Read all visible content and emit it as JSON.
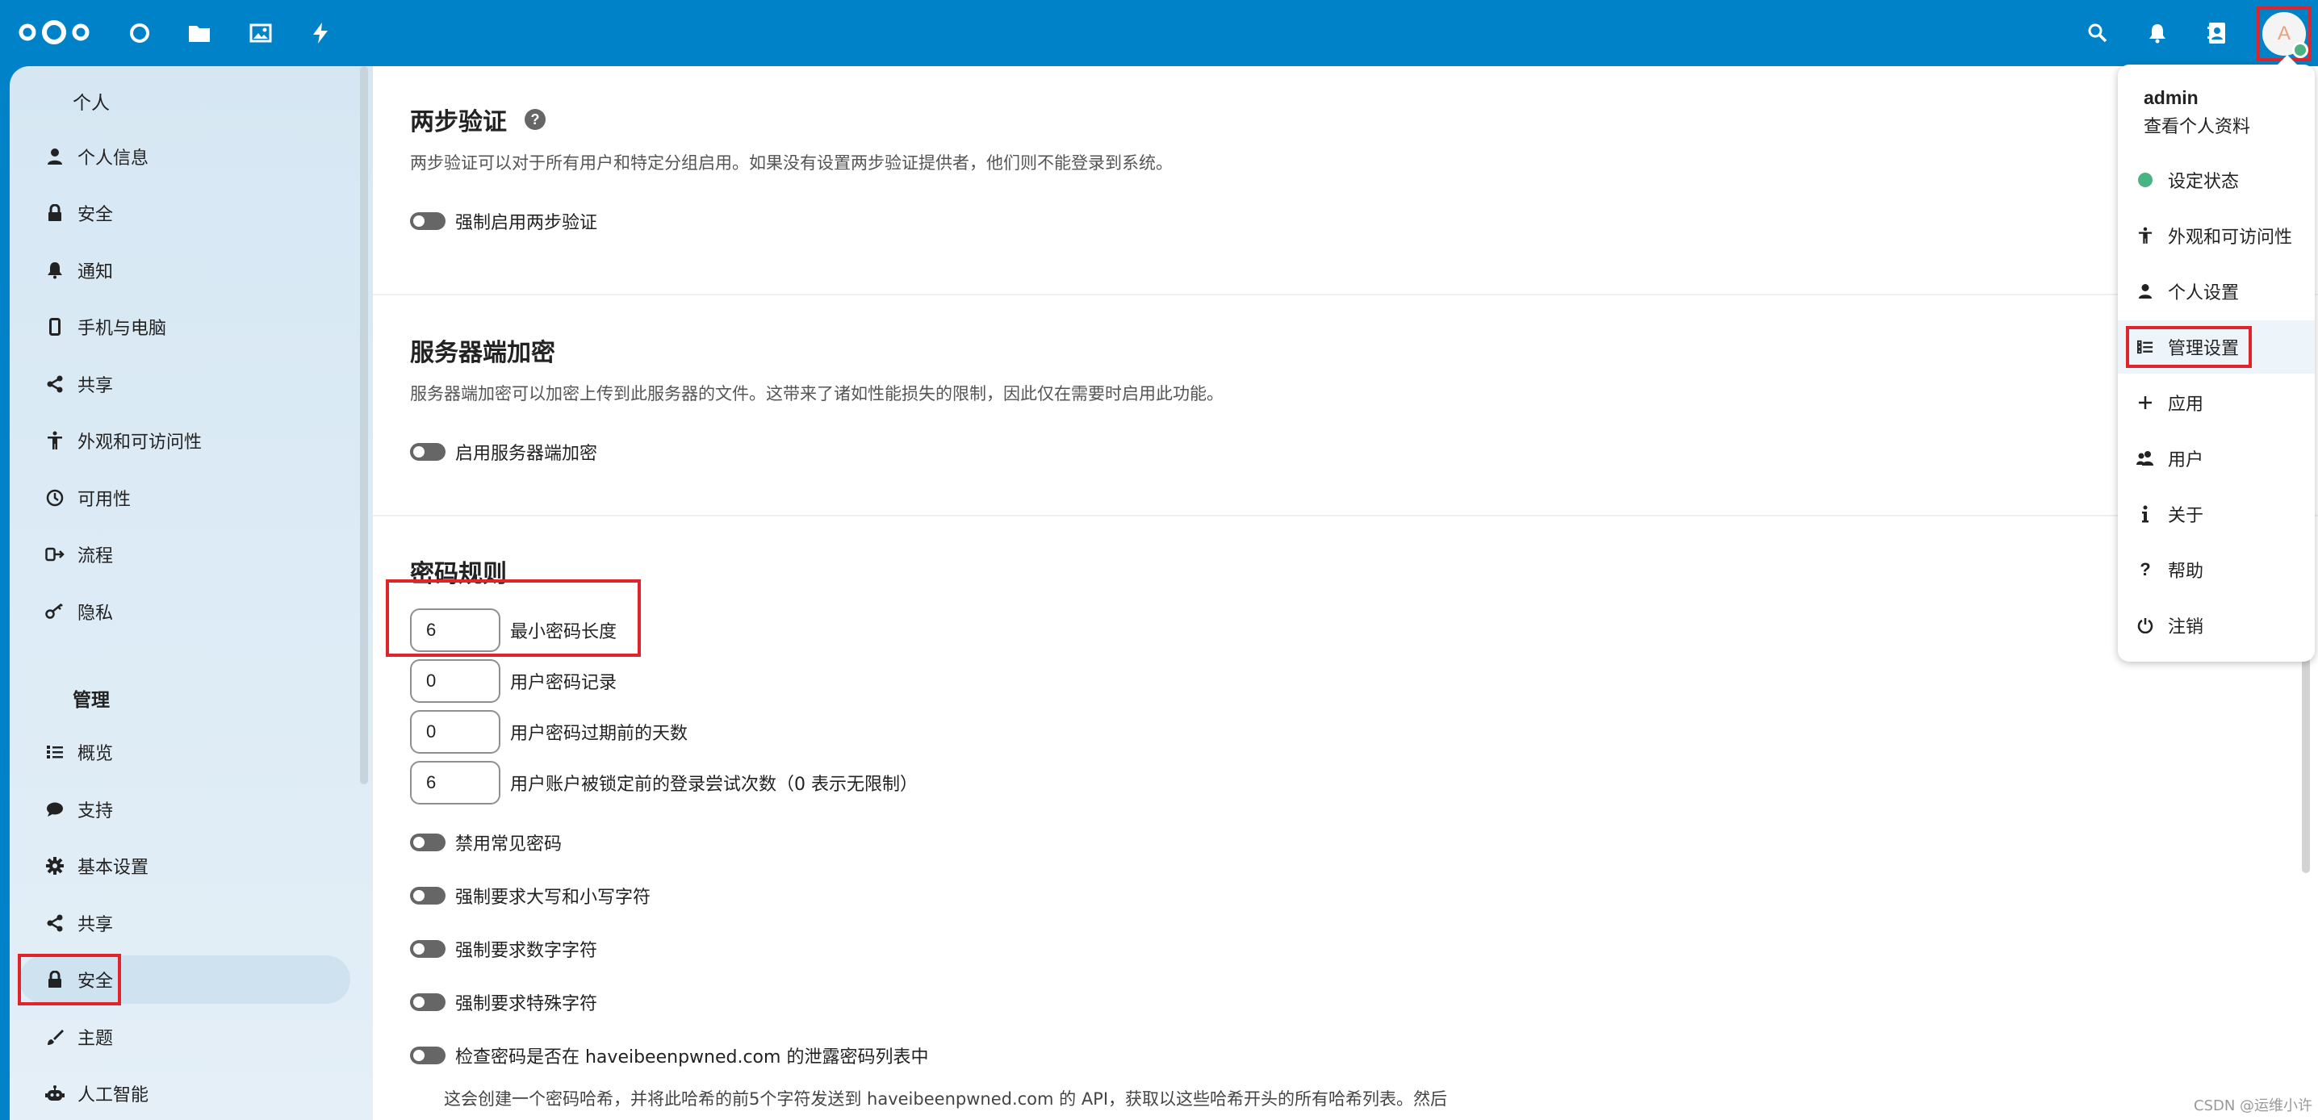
{
  "header": {
    "logo": "nextcloud-logo",
    "apps": [
      "dashboard",
      "files",
      "photos",
      "activity"
    ],
    "right_icons": [
      "search",
      "notifications",
      "contacts"
    ],
    "avatar_letter": "A",
    "status_color": "#49b382"
  },
  "sidebar": {
    "personal_title": "个人",
    "personal_items": [
      {
        "label": "个人信息",
        "icon": "person-icon"
      },
      {
        "label": "安全",
        "icon": "lock-icon"
      },
      {
        "label": "通知",
        "icon": "bell-icon"
      },
      {
        "label": "手机与电脑",
        "icon": "phone-icon"
      },
      {
        "label": "共享",
        "icon": "share-icon"
      },
      {
        "label": "外观和可访问性",
        "icon": "accessibility-icon"
      },
      {
        "label": "可用性",
        "icon": "clock-icon"
      },
      {
        "label": "流程",
        "icon": "flow-icon"
      },
      {
        "label": "隐私",
        "icon": "key-icon"
      }
    ],
    "admin_title": "管理",
    "admin_items": [
      {
        "label": "概览",
        "icon": "list-icon"
      },
      {
        "label": "支持",
        "icon": "chat-icon"
      },
      {
        "label": "基本设置",
        "icon": "gear-icon"
      },
      {
        "label": "共享",
        "icon": "share-icon"
      },
      {
        "label": "安全",
        "icon": "lock-icon"
      },
      {
        "label": "主题",
        "icon": "brush-icon"
      },
      {
        "label": "人工智能",
        "icon": "robot-icon"
      }
    ]
  },
  "main": {
    "twofactor": {
      "title": "两步验证",
      "description": "两步验证可以对于所有用户和特定分组启用。如果没有设置两步验证提供者，他们则不能登录到系统。",
      "toggle": "强制启用两步验证"
    },
    "encryption": {
      "title": "服务器端加密",
      "description": "服务器端加密可以加密上传到此服务器的文件。这带来了诸如性能损失的限制，因此仅在需要时启用此功能。",
      "toggle": "启用服务器端加密"
    },
    "password": {
      "title": "密码规则",
      "fields": [
        {
          "value": "6",
          "label": "最小密码长度"
        },
        {
          "value": "0",
          "label": "用户密码记录"
        },
        {
          "value": "0",
          "label": "用户密码过期前的天数"
        },
        {
          "value": "6",
          "label": "用户账户被锁定前的登录尝试次数（0 表示无限制）"
        }
      ],
      "toggles": [
        "禁用常见密码",
        "强制要求大写和小写字符",
        "强制要求数字字符",
        "强制要求特殊字符",
        "检查密码是否在 haveibeenpwned.com 的泄露密码列表中"
      ],
      "hibp_note": "这会创建一个密码哈希，并将此哈希的前5个字符发送到 haveibeenpwned.com 的 API，获取以这些哈希开头的所有哈希列表。然后"
    }
  },
  "menu": {
    "username": "admin",
    "profile_link": "查看个人资料",
    "items": [
      {
        "label": "设定状态",
        "icon": "status-dot-icon"
      },
      {
        "label": "外观和可访问性",
        "icon": "accessibility-icon"
      },
      {
        "label": "个人设置",
        "icon": "person-icon"
      },
      {
        "label": "管理设置",
        "icon": "admin-list-icon"
      },
      {
        "label": "应用",
        "icon": "plus-icon"
      },
      {
        "label": "用户",
        "icon": "users-icon"
      },
      {
        "label": "关于",
        "icon": "info-icon"
      },
      {
        "label": "帮助",
        "icon": "help-icon"
      },
      {
        "label": "注销",
        "icon": "power-icon"
      }
    ]
  },
  "watermark": "CSDN @运维小许"
}
